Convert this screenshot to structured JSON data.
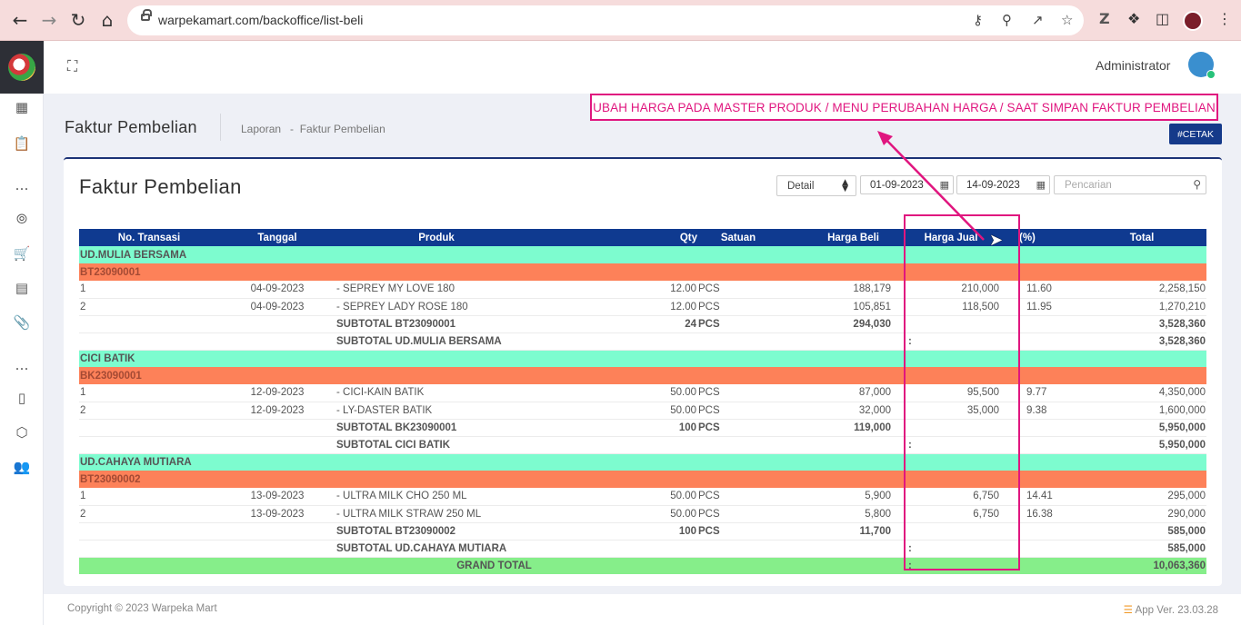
{
  "browser": {
    "url": "warpekamart.com/backoffice/list-beli"
  },
  "topbar": {
    "user_name": "Administrator"
  },
  "page": {
    "title": "Faktur Pembelian",
    "breadcrumb": "Laporan   -  Faktur Pembelian",
    "annotation": "UBAH HARGA PADA MASTER PRODUK / MENU PERUBAHAN HARGA / SAAT SIMPAN FAKTUR PEMBELIAN",
    "print_button": "#CETAK"
  },
  "card": {
    "title": "Faktur Pembelian",
    "mode_select": "Detail",
    "date_from": "01-09-2023",
    "date_to": "14-09-2023",
    "search_placeholder": "Pencarian"
  },
  "table": {
    "headers": [
      "No. Transasi",
      "Tanggal",
      "Produk",
      "Qty",
      "Satuan",
      "Harga Beli",
      "Harga Jual",
      "(%)",
      "Total"
    ],
    "supplier_1": "UD.MULIA BERSAMA",
    "invoice_1": "BT23090001",
    "rows_1": [
      [
        "1",
        "04-09-2023",
        "- SEPREY MY LOVE 180",
        "12.00",
        "PCS",
        "188,179",
        "210,000",
        "11.60",
        "2,258,150"
      ],
      [
        "2",
        "04-09-2023",
        "- SEPREY LADY ROSE 180",
        "12.00",
        "PCS",
        "105,851",
        "118,500",
        "11.95",
        "1,270,210"
      ]
    ],
    "subtotal_invoice_1": {
      "label": "SUBTOTAL BT23090001",
      "qty": "24",
      "unit": "PCS",
      "harga_beli": "294,030",
      "total": "3,528,360"
    },
    "subtotal_supplier_1": {
      "label": "SUBTOTAL UD.MULIA BERSAMA",
      "colon": ":",
      "total": "3,528,360"
    },
    "supplier_2": "CICI BATIK",
    "invoice_2": "BK23090001",
    "rows_2": [
      [
        "1",
        "12-09-2023",
        "- CICI-KAIN BATIK",
        "50.00",
        "PCS",
        "87,000",
        "95,500",
        "9.77",
        "4,350,000"
      ],
      [
        "2",
        "12-09-2023",
        "- LY-DASTER BATIK",
        "50.00",
        "PCS",
        "32,000",
        "35,000",
        "9.38",
        "1,600,000"
      ]
    ],
    "subtotal_invoice_2": {
      "label": "SUBTOTAL BK23090001",
      "qty": "100",
      "unit": "PCS",
      "harga_beli": "119,000",
      "total": "5,950,000"
    },
    "subtotal_supplier_2": {
      "label": "SUBTOTAL CICI BATIK",
      "colon": ":",
      "total": "5,950,000"
    },
    "supplier_3": "UD.CAHAYA MUTIARA",
    "invoice_3": "BT23090002",
    "rows_3": [
      [
        "1",
        "13-09-2023",
        "- ULTRA MILK CHO 250 ML",
        "50.00",
        "PCS",
        "5,900",
        "6,750",
        "14.41",
        "295,000"
      ],
      [
        "2",
        "13-09-2023",
        "- ULTRA MILK STRAW 250 ML",
        "50.00",
        "PCS",
        "5,800",
        "6,750",
        "16.38",
        "290,000"
      ]
    ],
    "subtotal_invoice_3": {
      "label": "SUBTOTAL BT23090002",
      "qty": "100",
      "unit": "PCS",
      "harga_beli": "11,700",
      "total": "585,000"
    },
    "subtotal_supplier_3": {
      "label": "SUBTOTAL UD.CAHAYA MUTIARA",
      "colon": ":",
      "total": "585,000"
    },
    "grand_total": {
      "label": "GRAND TOTAL",
      "colon": ":",
      "total": "10,063,360"
    }
  },
  "footer": {
    "copyright": "Copyright © 2023 Warpeka Mart",
    "version": "App Ver. 23.03.28"
  },
  "colors": {
    "header_blue": "#0f3a90",
    "supplier_row": "#7dfccf",
    "invoice_row": "#fd8159",
    "grand_total_row": "#86ee8a",
    "annotation_magenta": "#e0167f"
  }
}
